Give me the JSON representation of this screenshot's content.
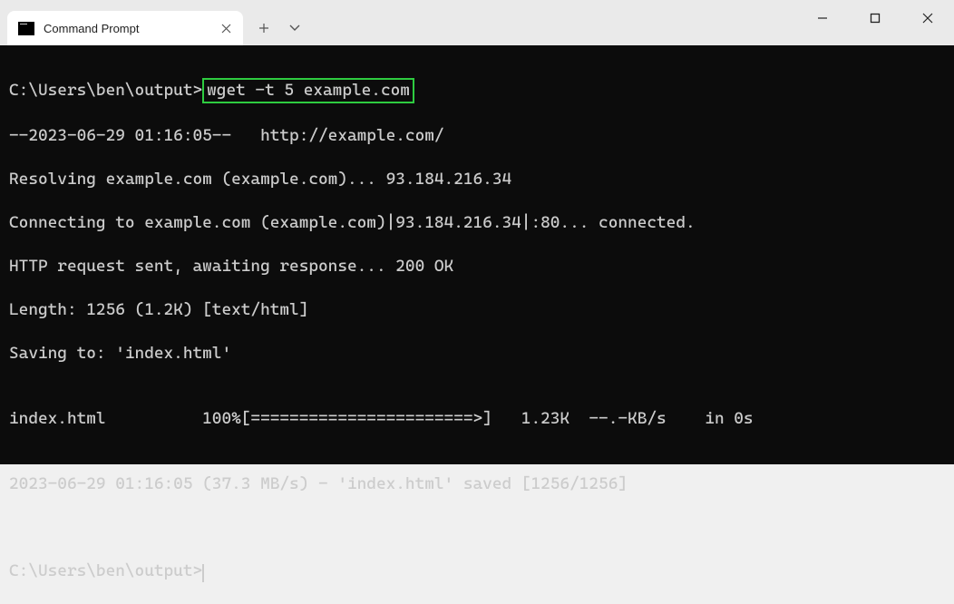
{
  "titlebar": {
    "tab_title": "Command Prompt"
  },
  "terminal": {
    "line1_prompt": "C:\\Users\\ben\\output>",
    "line1_cmd": "wget -t 5 example.com",
    "line2": "--2023-06-29 01:16:05--   http://example.com/",
    "line3": "Resolving example.com (example.com)... 93.184.216.34",
    "line4": "Connecting to example.com (example.com)|93.184.216.34|:80... connected.",
    "line5": "HTTP request sent, awaiting response... 200 OK",
    "line6": "Length: 1256 (1.2K) [text/html]",
    "line7": "Saving to: 'index.html'",
    "line8": "",
    "line9": "index.html          100%[=======================>]   1.23K  --.-KB/s    in 0s",
    "line10": "",
    "line11": "2023-06-29 01:16:05 (37.3 MB/s) - 'index.html' saved [1256/1256]",
    "line12": "",
    "line13": "",
    "line14_prompt": "C:\\Users\\ben\\output>"
  }
}
